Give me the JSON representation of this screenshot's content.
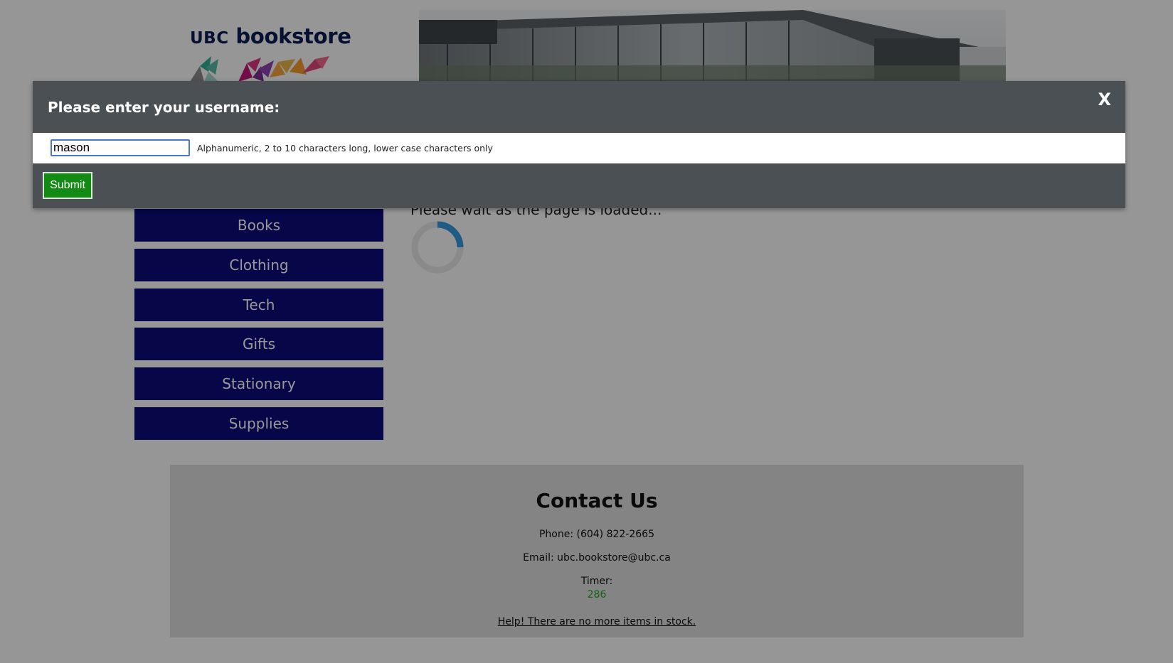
{
  "header": {
    "logo_text_prefix": "UBC",
    "logo_text_suffix": "bookstore"
  },
  "nav": {
    "items": [
      {
        "label": "Books"
      },
      {
        "label": "Clothing"
      },
      {
        "label": "Tech"
      },
      {
        "label": "Gifts"
      },
      {
        "label": "Stationary"
      },
      {
        "label": "Supplies"
      }
    ]
  },
  "main": {
    "loading_text": "Please wait as the page is loaded..."
  },
  "footer": {
    "title": "Contact Us",
    "phone": "Phone: (604) 822-2665",
    "email": "Email: ubc.bookstore@ubc.ca",
    "timer_label": "Timer:",
    "timer_value": "286",
    "help_link": "Help! There are no more items in stock."
  },
  "modal": {
    "title": "Please enter your username:",
    "close_label": "X",
    "username_value": "mason",
    "hint": "Alphanumeric, 2 to 10 characters long, lower case characters only",
    "submit_label": "Submit"
  },
  "colors": {
    "nav_bg": "#0b0a7a",
    "modal_bg": "#4b5054",
    "submit_bg": "#138a13",
    "timer_color": "#1aa31a",
    "logo_color": "#0b1b52"
  }
}
